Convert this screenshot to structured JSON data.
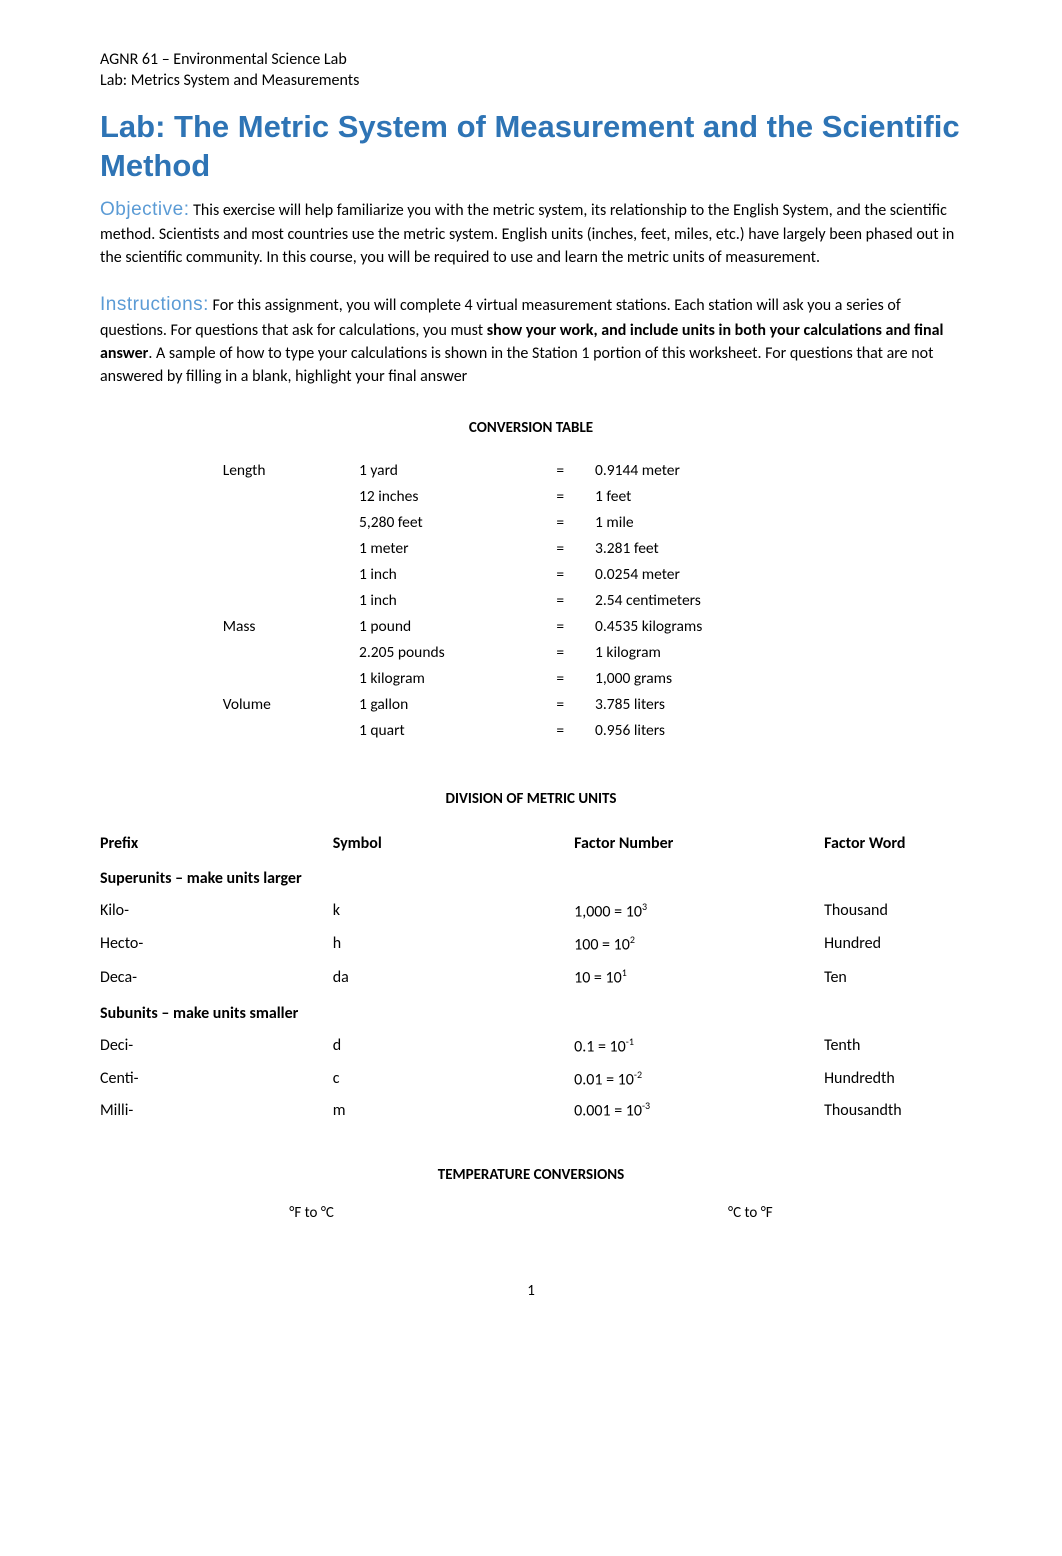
{
  "header": {
    "line1": "AGNR 61 – Environmental Science Lab",
    "line2": "Lab: Metrics System and Measurements"
  },
  "title": "Lab:  The Metric System of Measurement and the Scientific Method",
  "objective": {
    "label": "Objective:",
    "text": " This exercise will help familiarize you with the metric system, its relationship to the English System, and the scientific method.  Scientists and most countries use the metric system.  English units (inches, feet, miles, etc.) have largely been phased out in the scientific community.   In this course, you will be required to use and learn the metric units of measurement."
  },
  "instructions": {
    "label": "Instructions:",
    "part1": " For this assignment, you will complete 4 virtual measurement stations.  Each station will ask you a series of questions.  For questions that ask for calculations, you must ",
    "bold1": "show your work, and include units in both your calculations and ",
    "bold2_italic_f": "f",
    "bold3": "inal answer",
    "part2": ".  A sample of how to type your calculations is shown in the Station 1 portion of this worksheet.  For questions that are not answered by filling in a blank, highlight your final answer"
  },
  "conversion": {
    "title": "CONVERSION TABLE",
    "rows": [
      {
        "cat": "Length",
        "left": "1 yard",
        "eq": "=",
        "right": "0.9144 meter"
      },
      {
        "cat": "",
        "left": "12 inches",
        "eq": "=",
        "right": "1 feet"
      },
      {
        "cat": "",
        "left": "5,280 feet",
        "eq": "=",
        "right": "1 mile"
      },
      {
        "cat": "",
        "left": "1 meter",
        "eq": "=",
        "right": "3.281 feet"
      },
      {
        "cat": "",
        "left": "1 inch",
        "eq": "=",
        "right": "0.0254 meter"
      },
      {
        "cat": "",
        "left": "1 inch",
        "eq": "=",
        "right": "2.54 centimeters"
      },
      {
        "cat": "Mass",
        "left": "1 pound",
        "eq": "=",
        "right": "0.4535 kilograms"
      },
      {
        "cat": "",
        "left": "2.205 pounds",
        "eq": "=",
        "right": "1 kilogram"
      },
      {
        "cat": "",
        "left": "1 kilogram",
        "eq": "=",
        "right": "1,000 grams"
      },
      {
        "cat": "Volume",
        "left": "1 gallon",
        "eq": "=",
        "right": "3.785 liters"
      },
      {
        "cat": "",
        "left": "1 quart",
        "eq": "=",
        "right": "0.956 liters"
      }
    ]
  },
  "metric": {
    "title": "DIVISION OF METRIC UNITS",
    "headers": [
      "Prefix",
      "Symbol",
      "Factor Number",
      "Factor Word"
    ],
    "group1": "Superunits – make units larger",
    "group2": "Subunits – make units smaller",
    "superunits": [
      {
        "prefix": "Kilo-",
        "symbol": "k",
        "factor_base": "1,000 = 10",
        "factor_exp": "3",
        "word": "Thousand"
      },
      {
        "prefix": "Hecto-",
        "symbol": "h",
        "factor_base": "100 = 10",
        "factor_exp": "2",
        "word": "Hundred"
      },
      {
        "prefix": "Deca-",
        "symbol": "da",
        "factor_base": "10 = 10",
        "factor_exp": "1",
        "word": "Ten"
      }
    ],
    "subunits": [
      {
        "prefix": "Deci-",
        "symbol": "d",
        "factor_base": "0.1 = 10",
        "factor_exp": "-1",
        "word": "Tenth"
      },
      {
        "prefix": "Centi-",
        "symbol": "c",
        "factor_base": "0.01 = 10",
        "factor_exp": "-2",
        "word": "Hundredth"
      },
      {
        "prefix": "Milli-",
        "symbol": "m",
        "factor_base": "0.001 = 10",
        "factor_exp": "-3",
        "word": "Thousandth"
      }
    ]
  },
  "temperature": {
    "title": "TEMPERATURE CONVERSIONS",
    "left": "°F to °C",
    "right": "°C to °F"
  },
  "page_number": "1"
}
